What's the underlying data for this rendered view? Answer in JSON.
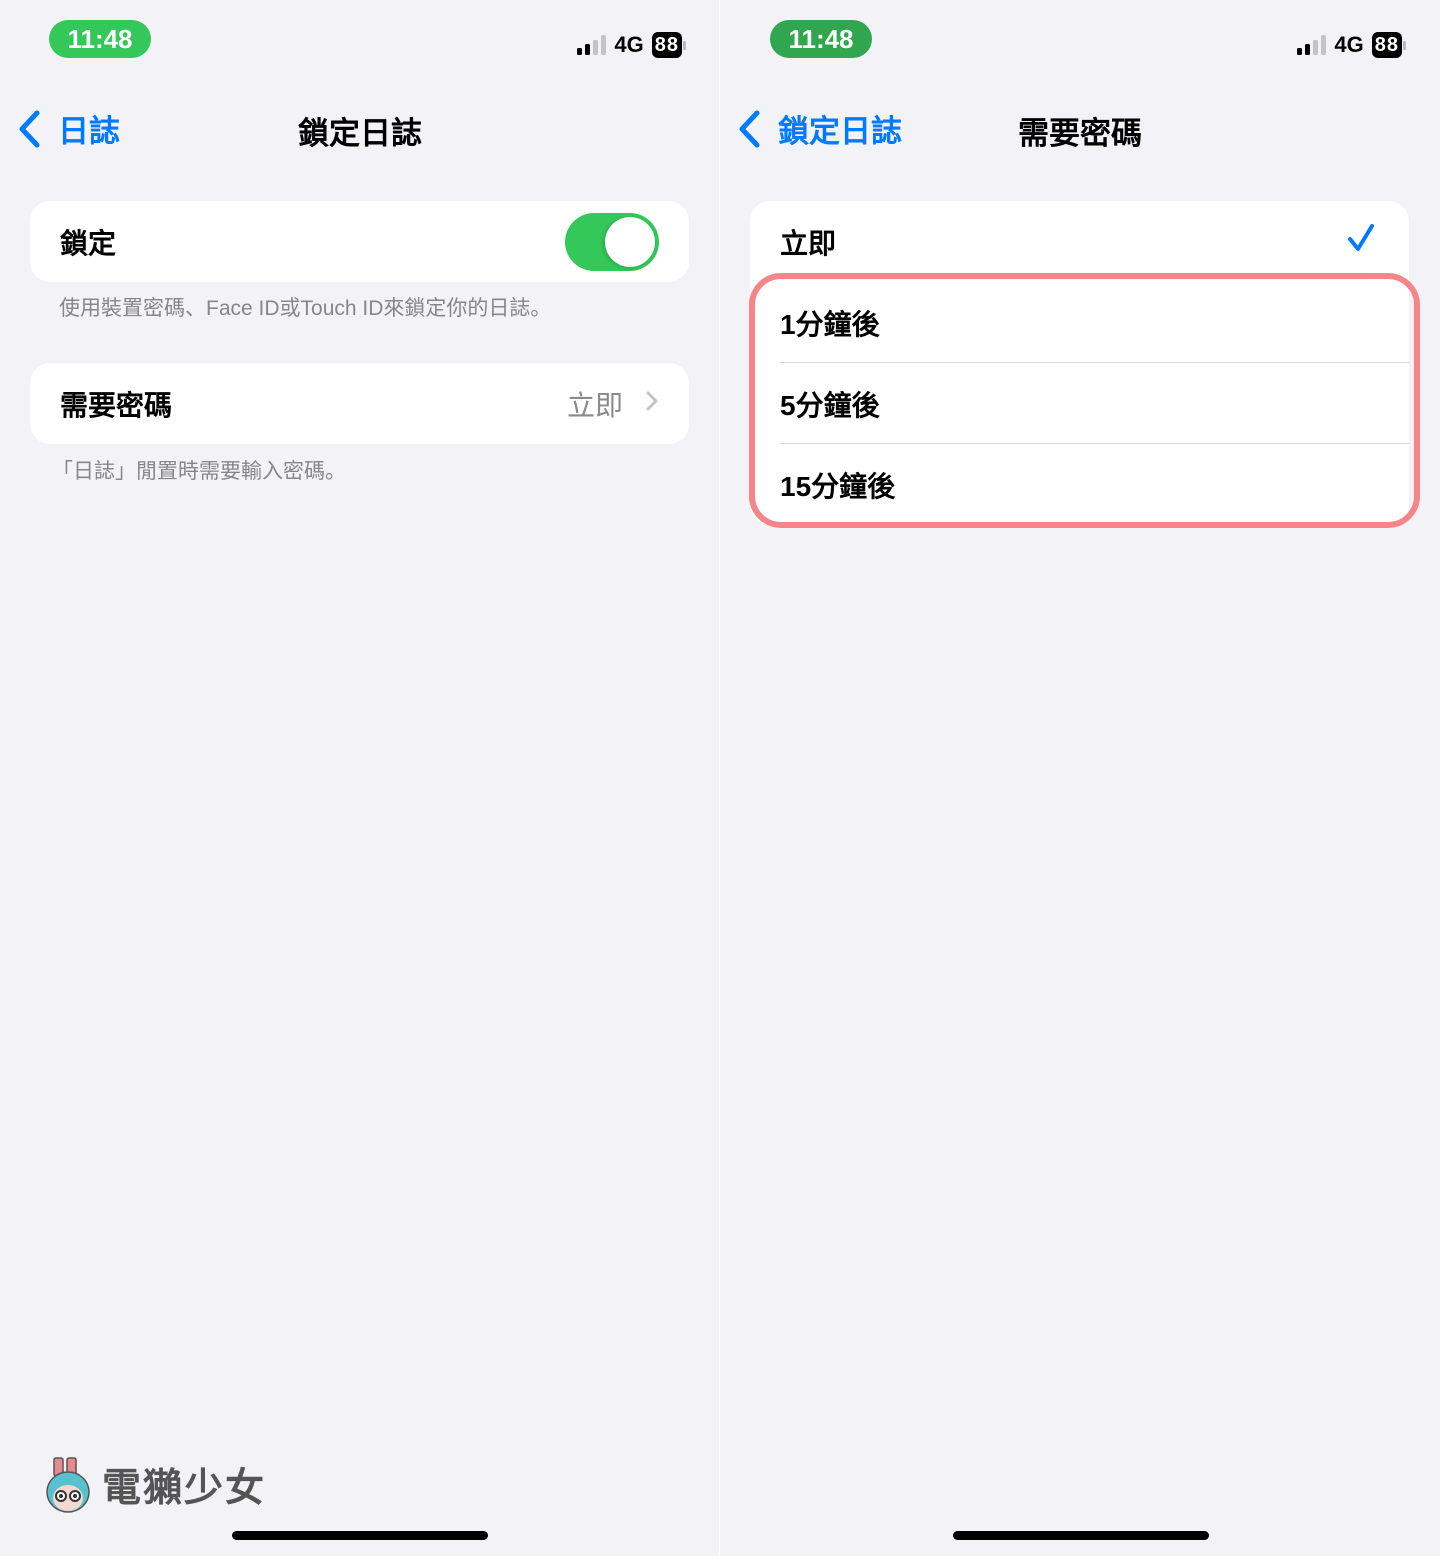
{
  "status_bar": {
    "time": "11:48",
    "network": "4G",
    "battery": "88",
    "signal_bars_active": 2,
    "signal_bars_total": 4
  },
  "left": {
    "nav": {
      "back_label": "日誌",
      "title": "鎖定日誌"
    },
    "lock_row": {
      "label": "鎖定",
      "toggle_on": true
    },
    "lock_footer": "使用裝置密碼、Face ID或Touch ID來鎖定你的日誌。",
    "passcode_row": {
      "label": "需要密碼",
      "value": "立即"
    },
    "passcode_footer": "「日誌」閒置時需要輸入密碼。",
    "watermark": "電獺少女"
  },
  "right": {
    "nav": {
      "back_label": "鎖定日誌",
      "title": "需要密碼"
    },
    "options": [
      {
        "label": "立即",
        "selected": true
      },
      {
        "label": "1分鐘後",
        "selected": false
      },
      {
        "label": "5分鐘後",
        "selected": false
      },
      {
        "label": "15分鐘後",
        "selected": false
      }
    ]
  },
  "colors": {
    "accent": "#007aff",
    "toggle_on": "#34c759",
    "highlight": "#f58589",
    "background": "#f2f2f7"
  }
}
